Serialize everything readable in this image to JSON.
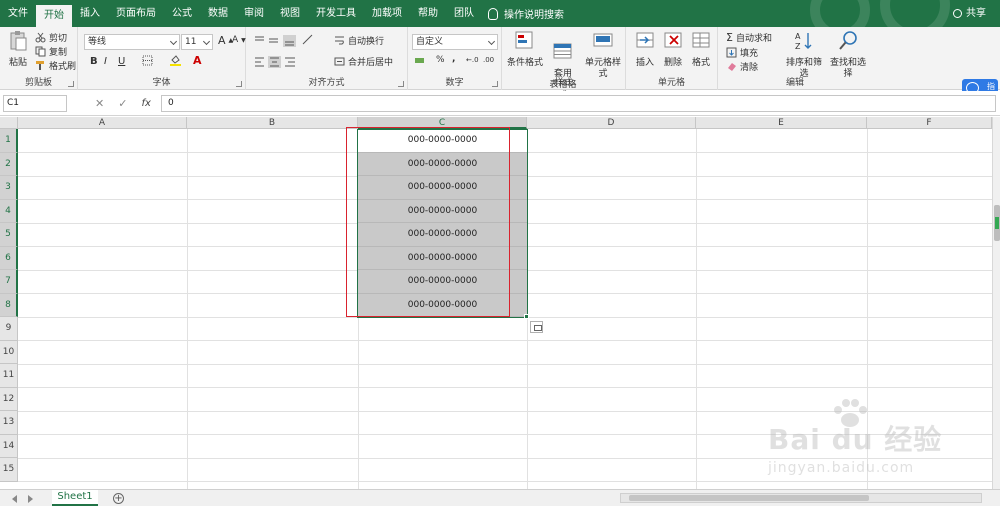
{
  "tabs": [
    "文件",
    "开始",
    "插入",
    "页面布局",
    "公式",
    "数据",
    "审阅",
    "视图",
    "开发工具",
    "加载项",
    "帮助",
    "团队"
  ],
  "active_tab": "开始",
  "search_label": "操作说明搜索",
  "share_label": "共享",
  "ribbon": {
    "clipboard": {
      "paste": "粘贴",
      "cut": "剪切",
      "copy": "复制",
      "format_painter": "格式刷",
      "label": "剪贴板"
    },
    "font": {
      "name": "等线",
      "size": "11",
      "bold": "B",
      "italic": "I",
      "underline": "U",
      "label": "字体"
    },
    "alignment": {
      "wrap": "自动换行",
      "merge": "合并后居中",
      "label": "对齐方式"
    },
    "number": {
      "format": "自定义",
      "percent": "%",
      "comma": ",",
      "label": "数字"
    },
    "styles": {
      "conditional": "条件格式",
      "table_format": "套用\n表格格式",
      "cell_styles": "单元格样式",
      "label": "样式"
    },
    "cells": {
      "insert": "插入",
      "delete": "删除",
      "format": "格式",
      "label": "单元格"
    },
    "editing": {
      "autosum": "自动求和",
      "fill": "填充",
      "clear": "清除",
      "sort": "排序和筛选",
      "find": "查找和选择",
      "label": "编辑"
    }
  },
  "side_widget_label": "指",
  "formula_bar": {
    "name_box": "C1",
    "cancel": "✕",
    "enter": "✓",
    "fx": "fx",
    "content": "0"
  },
  "grid": {
    "columns": [
      "A",
      "B",
      "C",
      "D",
      "E",
      "F"
    ],
    "rows": [
      "1",
      "2",
      "3",
      "4",
      "5",
      "6",
      "7",
      "8",
      "9",
      "10",
      "11",
      "12",
      "13",
      "14",
      "15"
    ],
    "selected_column": "C",
    "c_values": [
      "000-0000-0000",
      "000-0000-0000",
      "000-0000-0000",
      "000-0000-0000",
      "000-0000-0000",
      "000-0000-0000",
      "000-0000-0000",
      "000-0000-0000"
    ]
  },
  "sheet_tab": "Sheet1",
  "add_sheet": "+",
  "watermark": {
    "text": "Bai du 经验",
    "sub": "jingyan.baidu.com"
  },
  "colors": {
    "accent": "#217346",
    "selection_fill": "#c9c9c9",
    "annotation": "#d9232e"
  }
}
